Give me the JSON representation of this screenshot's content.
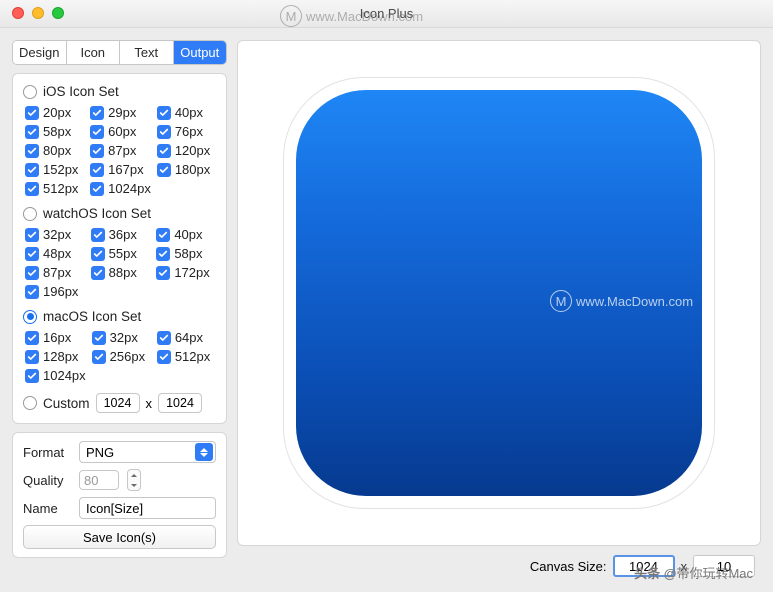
{
  "title": "Icon Plus",
  "tabs": [
    "Design",
    "Icon",
    "Text",
    "Output"
  ],
  "activeTab": 3,
  "sets": {
    "ios": {
      "label": "iOS Icon Set",
      "selected": false,
      "sizes": [
        "20px",
        "29px",
        "40px",
        "58px",
        "60px",
        "76px",
        "80px",
        "87px",
        "120px",
        "152px",
        "167px",
        "180px",
        "512px",
        "1024px"
      ]
    },
    "watch": {
      "label": "watchOS Icon Set",
      "selected": false,
      "sizes": [
        "32px",
        "36px",
        "40px",
        "48px",
        "55px",
        "58px",
        "87px",
        "88px",
        "172px",
        "196px"
      ]
    },
    "mac": {
      "label": "macOS Icon Set",
      "selected": true,
      "sizes": [
        "16px",
        "32px",
        "64px",
        "128px",
        "256px",
        "512px",
        "1024px"
      ]
    }
  },
  "custom": {
    "label": "Custom",
    "w": "1024",
    "x": "x",
    "h": "1024",
    "selected": false
  },
  "format": {
    "label": "Format",
    "value": "PNG"
  },
  "quality": {
    "label": "Quality",
    "value": "80"
  },
  "name": {
    "label": "Name",
    "value": "Icon[Size]"
  },
  "saveBtn": "Save Icon(s)",
  "canvas": {
    "label": "Canvas Size:",
    "w": "1024",
    "x": "x",
    "h": "10"
  },
  "watermark": "www.MacDown.com",
  "watermarkBadge": "M",
  "credit": {
    "prefix": "头条 @",
    "handle": "带你玩转Mac"
  }
}
